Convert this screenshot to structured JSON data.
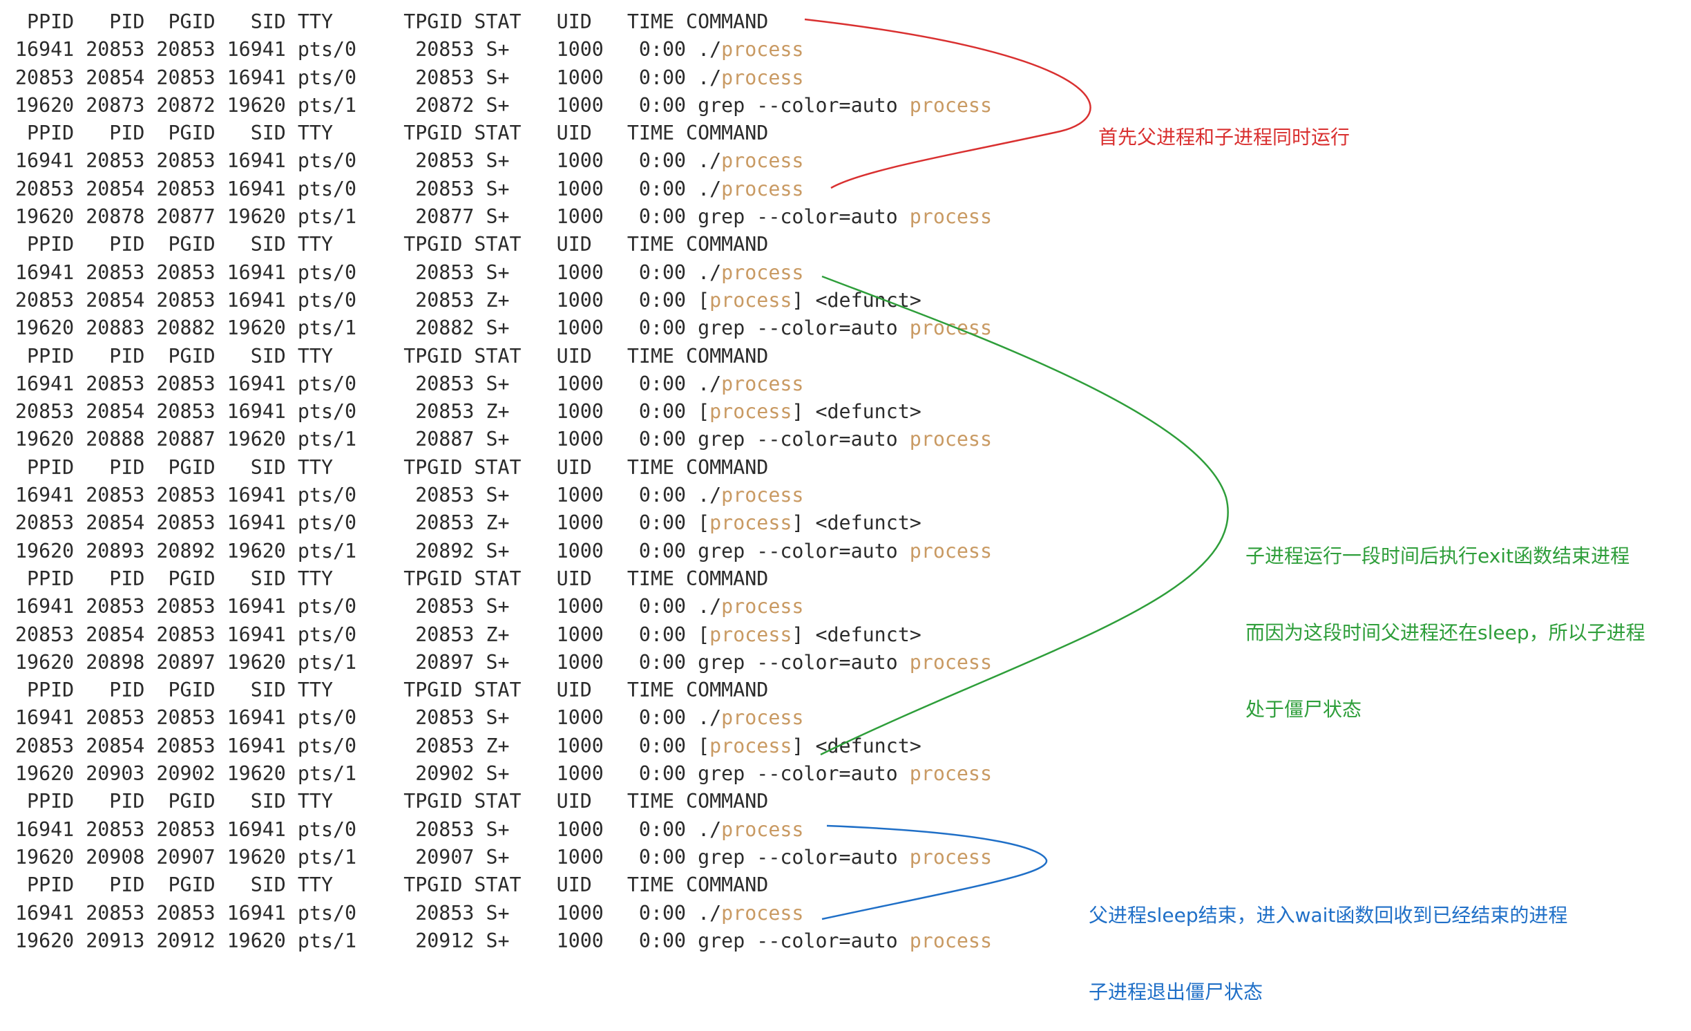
{
  "terminal": {
    "rows": [
      {
        "kind": "header",
        "text": " PPID   PID  PGID   SID TTY      TPGID STAT   UID   TIME COMMAND"
      },
      {
        "kind": "proc",
        "text": "16941 20853 20853 16941 pts/0     20853 S+    1000   0:00 ./",
        "hl": "process",
        "tail": ""
      },
      {
        "kind": "proc",
        "text": "20853 20854 20853 16941 pts/0     20853 S+    1000   0:00 ./",
        "hl": "process",
        "tail": ""
      },
      {
        "kind": "proc",
        "text": "19620 20873 20872 19620 pts/1     20872 S+    1000   0:00 grep --color=auto ",
        "hl": "process",
        "tail": ""
      },
      {
        "kind": "header",
        "text": " PPID   PID  PGID   SID TTY      TPGID STAT   UID   TIME COMMAND"
      },
      {
        "kind": "proc",
        "text": "16941 20853 20853 16941 pts/0     20853 S+    1000   0:00 ./",
        "hl": "process",
        "tail": ""
      },
      {
        "kind": "proc",
        "text": "20853 20854 20853 16941 pts/0     20853 S+    1000   0:00 ./",
        "hl": "process",
        "tail": ""
      },
      {
        "kind": "proc",
        "text": "19620 20878 20877 19620 pts/1     20877 S+    1000   0:00 grep --color=auto ",
        "hl": "process",
        "tail": ""
      },
      {
        "kind": "header",
        "text": " PPID   PID  PGID   SID TTY      TPGID STAT   UID   TIME COMMAND"
      },
      {
        "kind": "proc",
        "text": "16941 20853 20853 16941 pts/0     20853 S+    1000   0:00 ./",
        "hl": "process",
        "tail": ""
      },
      {
        "kind": "proc",
        "text": "20853 20854 20853 16941 pts/0     20853 Z+    1000   0:00 [",
        "hl": "process",
        "tail": "] <defunct>"
      },
      {
        "kind": "proc",
        "text": "19620 20883 20882 19620 pts/1     20882 S+    1000   0:00 grep --color=auto ",
        "hl": "process",
        "tail": ""
      },
      {
        "kind": "header",
        "text": " PPID   PID  PGID   SID TTY      TPGID STAT   UID   TIME COMMAND"
      },
      {
        "kind": "proc",
        "text": "16941 20853 20853 16941 pts/0     20853 S+    1000   0:00 ./",
        "hl": "process",
        "tail": ""
      },
      {
        "kind": "proc",
        "text": "20853 20854 20853 16941 pts/0     20853 Z+    1000   0:00 [",
        "hl": "process",
        "tail": "] <defunct>"
      },
      {
        "kind": "proc",
        "text": "19620 20888 20887 19620 pts/1     20887 S+    1000   0:00 grep --color=auto ",
        "hl": "process",
        "tail": ""
      },
      {
        "kind": "header",
        "text": " PPID   PID  PGID   SID TTY      TPGID STAT   UID   TIME COMMAND"
      },
      {
        "kind": "proc",
        "text": "16941 20853 20853 16941 pts/0     20853 S+    1000   0:00 ./",
        "hl": "process",
        "tail": ""
      },
      {
        "kind": "proc",
        "text": "20853 20854 20853 16941 pts/0     20853 Z+    1000   0:00 [",
        "hl": "process",
        "tail": "] <defunct>"
      },
      {
        "kind": "proc",
        "text": "19620 20893 20892 19620 pts/1     20892 S+    1000   0:00 grep --color=auto ",
        "hl": "process",
        "tail": ""
      },
      {
        "kind": "header",
        "text": " PPID   PID  PGID   SID TTY      TPGID STAT   UID   TIME COMMAND"
      },
      {
        "kind": "proc",
        "text": "16941 20853 20853 16941 pts/0     20853 S+    1000   0:00 ./",
        "hl": "process",
        "tail": ""
      },
      {
        "kind": "proc",
        "text": "20853 20854 20853 16941 pts/0     20853 Z+    1000   0:00 [",
        "hl": "process",
        "tail": "] <defunct>"
      },
      {
        "kind": "proc",
        "text": "19620 20898 20897 19620 pts/1     20897 S+    1000   0:00 grep --color=auto ",
        "hl": "process",
        "tail": ""
      },
      {
        "kind": "header",
        "text": " PPID   PID  PGID   SID TTY      TPGID STAT   UID   TIME COMMAND"
      },
      {
        "kind": "proc",
        "text": "16941 20853 20853 16941 pts/0     20853 S+    1000   0:00 ./",
        "hl": "process",
        "tail": ""
      },
      {
        "kind": "proc",
        "text": "20853 20854 20853 16941 pts/0     20853 Z+    1000   0:00 [",
        "hl": "process",
        "tail": "] <defunct>"
      },
      {
        "kind": "proc",
        "text": "19620 20903 20902 19620 pts/1     20902 S+    1000   0:00 grep --color=auto ",
        "hl": "process",
        "tail": ""
      },
      {
        "kind": "header",
        "text": " PPID   PID  PGID   SID TTY      TPGID STAT   UID   TIME COMMAND"
      },
      {
        "kind": "proc",
        "text": "16941 20853 20853 16941 pts/0     20853 S+    1000   0:00 ./",
        "hl": "process",
        "tail": ""
      },
      {
        "kind": "proc",
        "text": "19620 20908 20907 19620 pts/1     20907 S+    1000   0:00 grep --color=auto ",
        "hl": "process",
        "tail": ""
      },
      {
        "kind": "header",
        "text": " PPID   PID  PGID   SID TTY      TPGID STAT   UID   TIME COMMAND"
      },
      {
        "kind": "proc",
        "text": "16941 20853 20853 16941 pts/0     20853 S+    1000   0:00 ./",
        "hl": "process",
        "tail": ""
      },
      {
        "kind": "proc",
        "text": "19620 20913 20912 19620 pts/1     20912 S+    1000   0:00 grep --color=auto ",
        "hl": "process",
        "tail": ""
      }
    ],
    "colors": {
      "text": "#2b2b2b",
      "highlight": "#c99a63",
      "background": "#ffffff"
    }
  },
  "annotations": {
    "red": {
      "color": "#d93030",
      "lines": [
        "首先父进程和子进程同时运行"
      ]
    },
    "green": {
      "color": "#2e9e3a",
      "lines": [
        "子进程运行一段时间后执行exit函数结束进程",
        "而因为这段时间父进程还在sleep，所以子进程",
        "处于僵尸状态"
      ]
    },
    "blue": {
      "color": "#1f6fc7",
      "lines": [
        "父进程sleep结束，进入wait函数回收到已经结束的进程",
        "子进程退出僵尸状态"
      ]
    }
  }
}
